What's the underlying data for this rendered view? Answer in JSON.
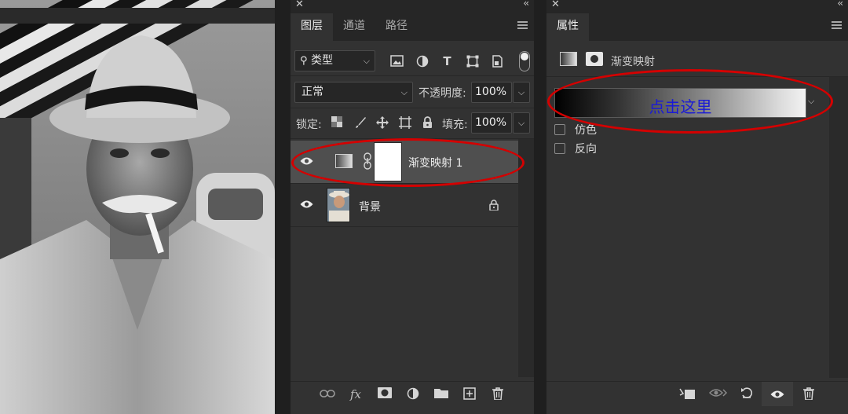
{
  "layers_panel": {
    "tabs": [
      {
        "label": "图层",
        "active": true
      },
      {
        "label": "通道",
        "active": false
      },
      {
        "label": "路径",
        "active": false
      }
    ],
    "filter_kind": "类型",
    "blend_mode": "正常",
    "opacity_label": "不透明度:",
    "opacity_value": "100%",
    "lock_label": "锁定:",
    "fill_label": "填充:",
    "fill_value": "100%",
    "layers": [
      {
        "name": "渐变映射 1",
        "type": "gradient-map-adjustment",
        "visible": true,
        "selected": true
      },
      {
        "name": "背景",
        "type": "image",
        "visible": true,
        "locked": true
      }
    ],
    "footer_icons": [
      "link-icon",
      "fx-icon",
      "mask-icon",
      "adjustment-icon",
      "folder-icon",
      "new-layer-icon",
      "trash-icon"
    ]
  },
  "properties_panel": {
    "tab": "属性",
    "title": "渐变映射",
    "gradient_annotation": "点击这里",
    "checkboxes": [
      {
        "label": "仿色",
        "checked": false
      },
      {
        "label": "反向",
        "checked": false
      }
    ],
    "footer_icons": [
      "clip-icon",
      "view-previous-icon",
      "reset-icon",
      "visibility-icon",
      "trash-icon"
    ]
  },
  "colors": {
    "panel_bg": "#323232",
    "header_bg": "#262626",
    "selected_layer_bg": "#4f4f4f",
    "annotation_ellipse": "#d40000",
    "annotation_text": "#1a1ad6"
  }
}
